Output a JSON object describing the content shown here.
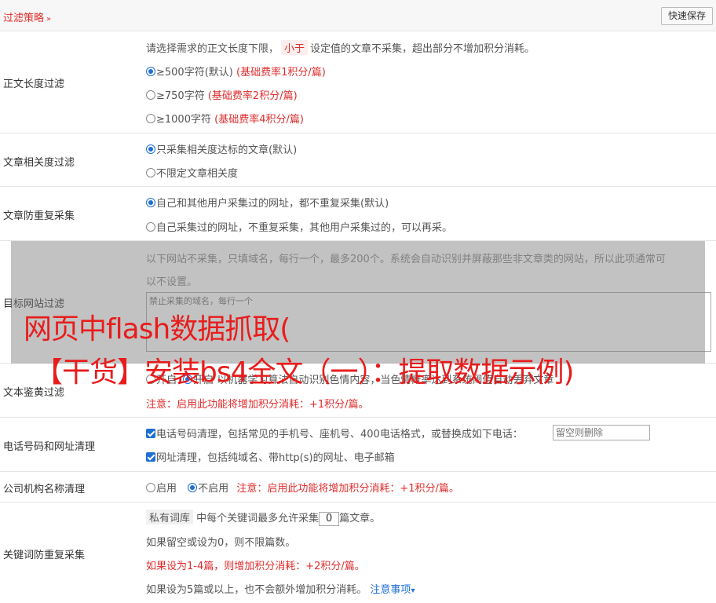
{
  "header": {
    "title": "过滤策略",
    "save_label": "快速保存"
  },
  "content_length": {
    "label": "正文长度过滤",
    "desc_before": "请选择需求的正文长度下限，",
    "desc_tag": "小于",
    "desc_after": "设定值的文章不采集，超出部分不增加积分消耗。",
    "options": [
      {
        "text": "≥500字符(默认)",
        "note": "(基础费率1积分/篇)",
        "selected": true
      },
      {
        "text": "≥750字符",
        "note": "(基础费率2积分/篇)",
        "selected": false
      },
      {
        "text": "≥1000字符",
        "note": "(基础费率4积分/篇)",
        "selected": false
      }
    ]
  },
  "relevance": {
    "label": "文章相关度过滤",
    "options": [
      {
        "text": "只采集相关度达标的文章(默认)",
        "selected": true
      },
      {
        "text": "不限定文章相关度",
        "selected": false
      }
    ]
  },
  "dedup": {
    "label": "文章防重复采集",
    "options": [
      {
        "text": "自己和其他用户采集过的网址，都不重复采集(默认)",
        "selected": true
      },
      {
        "text": "自己采集过的网址，不重复采集，其他用户采集过的，可以再采。",
        "selected": false
      }
    ]
  },
  "target_sites": {
    "label": "目标网站过滤",
    "desc_line1": "以下网站不采集，只填域名，每行一个，最多200个。系统会自动识别并屏蔽那些非文章类的网站，所以此项通常可",
    "desc_line2": "以不设置。",
    "placeholder": "禁止采集的域名，每行一个"
  },
  "porn_filter": {
    "label": "文本鉴黄过滤",
    "option_off": "开启",
    "option_on": "开启",
    "option_on_desc": "以机器学习算法自动识别色情内容，当色情概率达到系统阈值自动丢弃文章",
    "note": "注意：启用此功能将增加积分消耗：+1积分/篇。"
  },
  "phone_url": {
    "label": "电话号码和网址清理",
    "phone_text": "电话号码清理，包括常见的手机号、座机号、400电话格式，或替换成如下电话：",
    "phone_placeholder": "留空则删除",
    "url_text": "网址清理，包括纯域名、带http(s)的网址、电子邮箱"
  },
  "company": {
    "label": "公司机构名称清理",
    "opt_enable": "启用",
    "opt_disable": "不启用",
    "note": "注意：启用此功能将增加积分消耗：+1积分/篇。"
  },
  "keyword_dedup": {
    "label": "关键词防重复采集",
    "tag": "私有词库",
    "text_before": "中每个关键词最多允许采集",
    "count": "0",
    "text_after": "篇文章。",
    "line2": "如果留空或设为0，则不限篇数。",
    "line3": "如果设为1-4篇，则增加积分消耗：+2积分/篇。",
    "line4": "如果设为5篇或以上，也不会额外增加积分消耗。",
    "notice_link": "注意事项"
  },
  "overlay": {
    "line1": "网页中flash数据抓取(",
    "line2": "【干货】安装bs4全文（一）：提取数据示例)"
  },
  "colors": {
    "accent_red": "#e02d2d",
    "accent_blue": "#1e6fd6"
  }
}
